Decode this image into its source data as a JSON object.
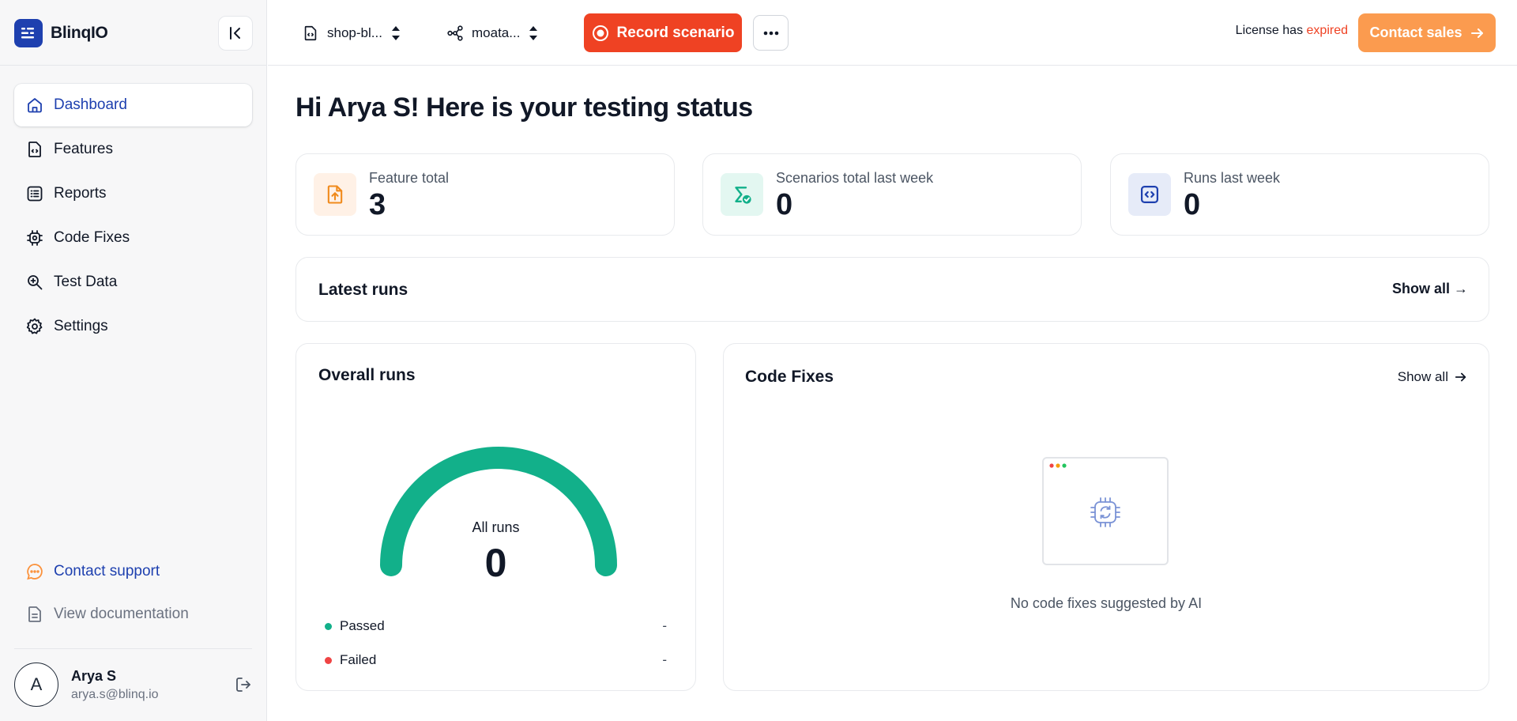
{
  "app": {
    "brand": "BlinqIO"
  },
  "sidebar": {
    "items": [
      {
        "label": "Dashboard",
        "icon": "home-icon",
        "active": true
      },
      {
        "label": "Features",
        "icon": "features-icon"
      },
      {
        "label": "Reports",
        "icon": "reports-icon"
      },
      {
        "label": "Code Fixes",
        "icon": "code-fixes-icon"
      },
      {
        "label": "Test Data",
        "icon": "test-data-icon"
      },
      {
        "label": "Settings",
        "icon": "gear-icon"
      }
    ],
    "support": {
      "contact_support": "Contact support",
      "view_documentation": "View documentation"
    },
    "user": {
      "initial": "A",
      "name": "Arya S",
      "email": "arya.s@blinq.io"
    }
  },
  "header": {
    "project_selector": "shop-bl...",
    "environment_selector": "moata...",
    "record_button": "Record scenario",
    "license_prefix": "License has",
    "license_status": "expired",
    "contact_sales": "Contact sales"
  },
  "main": {
    "title": "Hi Arya S! Here is your testing status",
    "stats": [
      {
        "label": "Feature total",
        "value": "3"
      },
      {
        "label": "Scenarios total last week",
        "value": "0"
      },
      {
        "label": "Runs last week",
        "value": "0"
      }
    ],
    "latest_runs": {
      "title": "Latest runs",
      "show_all": "Show all →"
    },
    "overall_runs": {
      "title": "Overall runs",
      "gauge_label": "All runs",
      "gauge_value": "0",
      "legend": [
        {
          "label": "Passed",
          "value": "-",
          "color": "#12b08a"
        },
        {
          "label": "Failed",
          "value": "-",
          "color": "#ef4444"
        }
      ]
    },
    "code_fixes": {
      "title": "Code Fixes",
      "show_all": "Show all",
      "empty_message": "No code fixes suggested by AI"
    }
  },
  "colors": {
    "brand_blue": "#1e40af",
    "record_red": "#ef4223",
    "contact_orange": "#fb9b4f",
    "gauge_green": "#12b08a"
  }
}
